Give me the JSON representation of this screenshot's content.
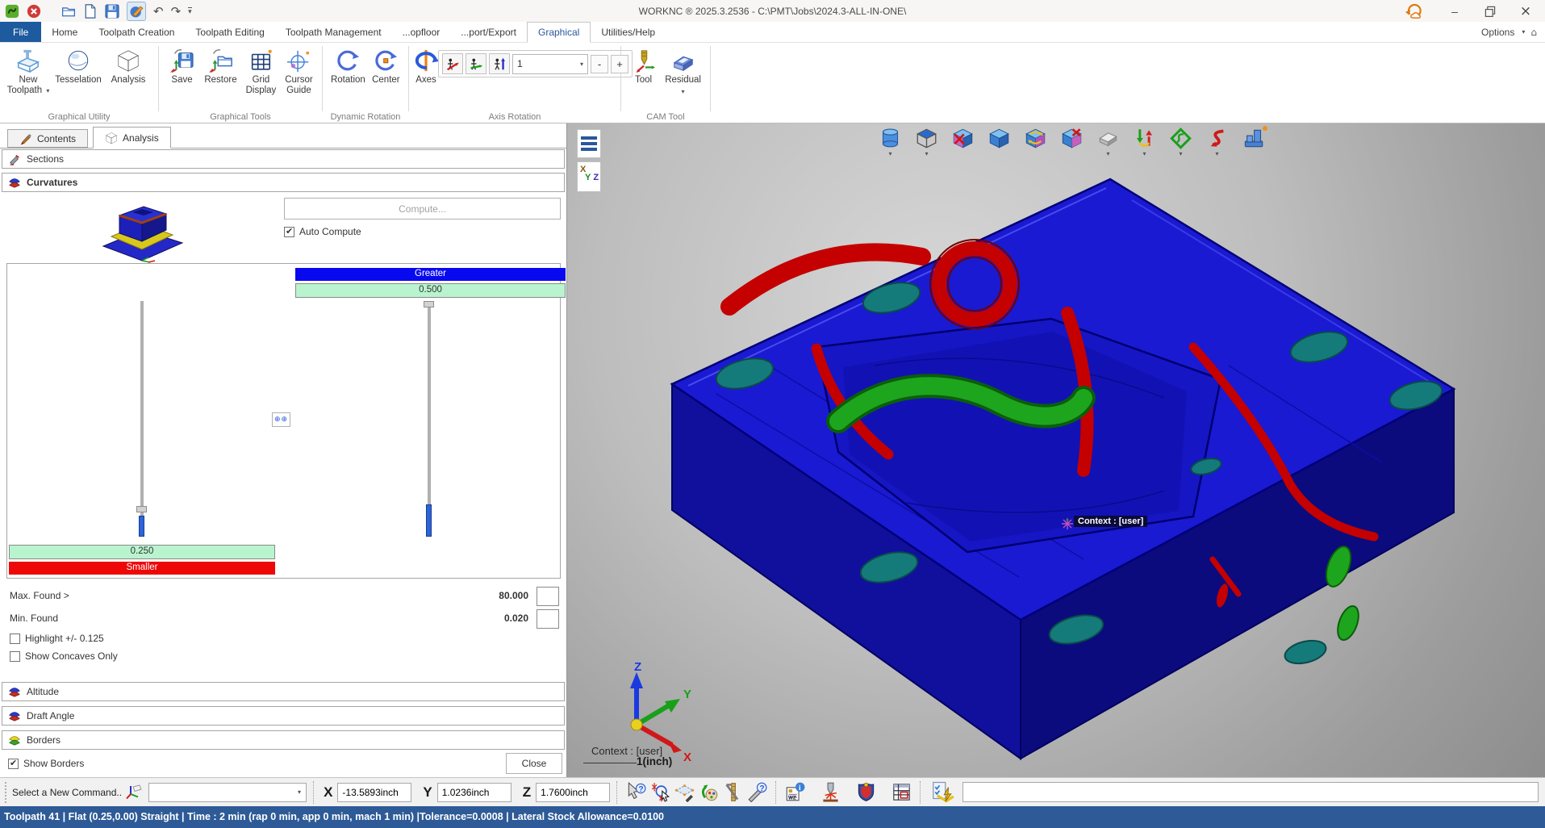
{
  "window": {
    "title": "WORKNC ® 2025.3.2536 - C:\\PMT\\Jobs\\2024.3-ALL-IN-ONE\\",
    "quick_access_icons": [
      "worknc-logo",
      "close-document",
      "open-folder",
      "new-document",
      "save",
      "worknc-edit",
      "undo",
      "redo",
      "customize-toolbar"
    ],
    "control_icons": [
      "cloud-sync",
      "minimize",
      "restore",
      "close"
    ]
  },
  "menu": {
    "tabs": [
      {
        "label": "File"
      },
      {
        "label": "Home"
      },
      {
        "label": "Toolpath Creation"
      },
      {
        "label": "Toolpath Editing"
      },
      {
        "label": "Toolpath Management"
      },
      {
        "label": "...opfloor"
      },
      {
        "label": "...port/Export"
      },
      {
        "label": "Graphical"
      },
      {
        "label": "Utilities/Help"
      }
    ],
    "active_tab": "Graphical",
    "options_label": "Options"
  },
  "ribbon": {
    "groups": [
      {
        "label": "Graphical Utility",
        "items": [
          {
            "label": "New Toolpath",
            "dropdown": true
          },
          {
            "label": "Tesselation"
          },
          {
            "label": "Analysis"
          }
        ]
      },
      {
        "label": "Graphical Tools",
        "items": [
          {
            "label": "Save"
          },
          {
            "label": "Restore"
          },
          {
            "label": "Grid Display"
          },
          {
            "label": "Cursor Guide"
          }
        ]
      },
      {
        "label": "Dynamic Rotation",
        "items": [
          {
            "label": "Rotation"
          },
          {
            "label": "Center"
          }
        ]
      },
      {
        "label": "Axis Rotation",
        "items": [
          {
            "label": "Axes"
          }
        ],
        "axis_buttons": [
          "rotate-x",
          "rotate-y",
          "rotate-z"
        ],
        "step_value": "1",
        "minus_label": "-",
        "plus_label": "+"
      },
      {
        "label": "CAM Tool",
        "items": [
          {
            "label": "Tool"
          },
          {
            "label": "Residual",
            "dropdown": true
          }
        ]
      }
    ]
  },
  "panel": {
    "tabs": [
      {
        "label": "Contents"
      },
      {
        "label": "Analysis"
      }
    ],
    "active_tab": "Analysis",
    "sections_label": "Sections",
    "curvatures_label": "Curvatures",
    "compute_label": "Compute...",
    "auto_compute": {
      "label": "Auto Compute",
      "checked": true
    },
    "scale": {
      "greater_label": "Greater",
      "upper_value": "0.500",
      "lower_value": "0.250",
      "smaller_label": "Smaller"
    },
    "max_found_label": "Max. Found >",
    "max_found_value": "80.000",
    "min_found_label": "Min. Found",
    "min_found_value": "0.020",
    "highlight": {
      "label": "Highlight +/- 0.125",
      "checked": false
    },
    "show_concaves": {
      "label": "Show Concaves Only",
      "checked": false
    },
    "altitude_label": "Altitude",
    "draft_angle_label": "Draft Angle",
    "borders_label": "Borders",
    "show_borders": {
      "label": "Show Borders",
      "checked": true
    },
    "close_label": "Close"
  },
  "viewport": {
    "toolbar_icons": [
      "cylinder-view",
      "cube-faces-view",
      "hide-entities",
      "show-entities",
      "refresh-entities",
      "delete-entities",
      "stock-model",
      "toolpath-links",
      "boundary-curves",
      "guide-curves",
      "machine-simulation"
    ],
    "xyz_button": {
      "x": "X",
      "y": "Y",
      "z": "Z"
    },
    "context_overlay_label": "Context : [user]",
    "context_corner_label": "Context : [user]",
    "scale_label": "1(inch)",
    "triad": {
      "x": "X",
      "y": "Y",
      "z": "Z"
    }
  },
  "command_bar": {
    "prompt": "Select a New Command..",
    "combo_value": "",
    "x_label": "X",
    "x_value": "-13.5893inch",
    "y_label": "Y",
    "y_value": "1.0236inch",
    "z_label": "Z",
    "z_value": "1.7600inch",
    "glyphs": {
      "help1": "?",
      "help2": "?",
      "wz": "WZ",
      "info": "i"
    },
    "tool_icons": [
      "pointer-help",
      "point-select",
      "surface-select",
      "palette-arrow",
      "caliper-measure",
      "pen-help",
      "info-workzone",
      "tool-spark",
      "postprocessor-shield",
      "table-form",
      "checklist-lightning"
    ]
  },
  "status_bar": {
    "text": "Toolpath 41 | Flat (0.25,0.00) Straight | Time : 2 min (rap 0 min, app 0 min, mach 1 min) |Tolerance=0.0008 | Lateral Stock Allowance=0.0100"
  },
  "colors": {
    "accent_blue": "#2e5b97",
    "file_tab_blue": "#1e5a9e",
    "scale_greater": "#0909f0",
    "scale_band_green": "#b9f4cf",
    "scale_smaller_red": "#ee0707",
    "model_blue": "#1a1ad2",
    "concave_red": "#c40000",
    "convex_green": "#1ea51e",
    "hole_teal": "#157a7a"
  }
}
